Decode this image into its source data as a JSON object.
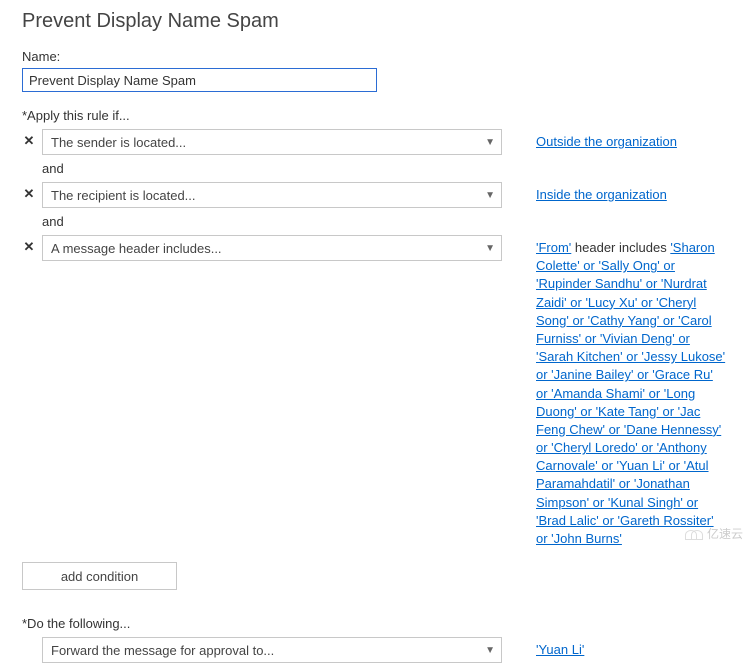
{
  "page_title": "Prevent Display Name Spam",
  "name_field": {
    "label": "Name:",
    "value": "Prevent Display Name Spam"
  },
  "apply_rule": {
    "label": "*Apply this rule if...",
    "conditions": [
      {
        "dropdown_text": "The sender is located...",
        "link_parts": [
          {
            "type": "link",
            "text": "Outside the organization"
          }
        ]
      },
      {
        "dropdown_text": "The recipient is located...",
        "link_parts": [
          {
            "type": "link",
            "text": "Inside the organization"
          }
        ]
      },
      {
        "dropdown_text": "A message header includes...",
        "link_parts": [
          {
            "type": "link",
            "text": "'From'"
          },
          {
            "type": "plain",
            "text": " header includes "
          },
          {
            "type": "link",
            "text": "'Sharon Colette' or 'Sally Ong' or 'Rupinder Sandhu' or 'Nurdrat Zaidi' or 'Lucy Xu' or 'Cheryl Song' or 'Cathy Yang' or 'Carol Furniss' or 'Vivian Deng' or 'Sarah Kitchen' or 'Jessy Lukose' or 'Janine Bailey' or 'Grace Ru' or 'Amanda Shami' or 'Long Duong' or 'Kate Tang' or 'Jac Feng Chew' or 'Dane Hennessy' or 'Cheryl Loredo' or 'Anthony Carnovale' or 'Yuan Li' or 'Atul Paramahdatil' or 'Jonathan Simpson' or 'Kunal Singh' or 'Brad Lalic' or 'Gareth Rossiter' or 'John Burns'"
          }
        ]
      }
    ],
    "and_label": "and",
    "add_condition_label": "add condition"
  },
  "do_following": {
    "label": "*Do the following...",
    "actions": [
      {
        "dropdown_text": "Forward the message for approval to...",
        "link_parts": [
          {
            "type": "link",
            "text": "'Yuan Li'"
          }
        ]
      }
    ]
  },
  "watermark_text": "亿速云"
}
